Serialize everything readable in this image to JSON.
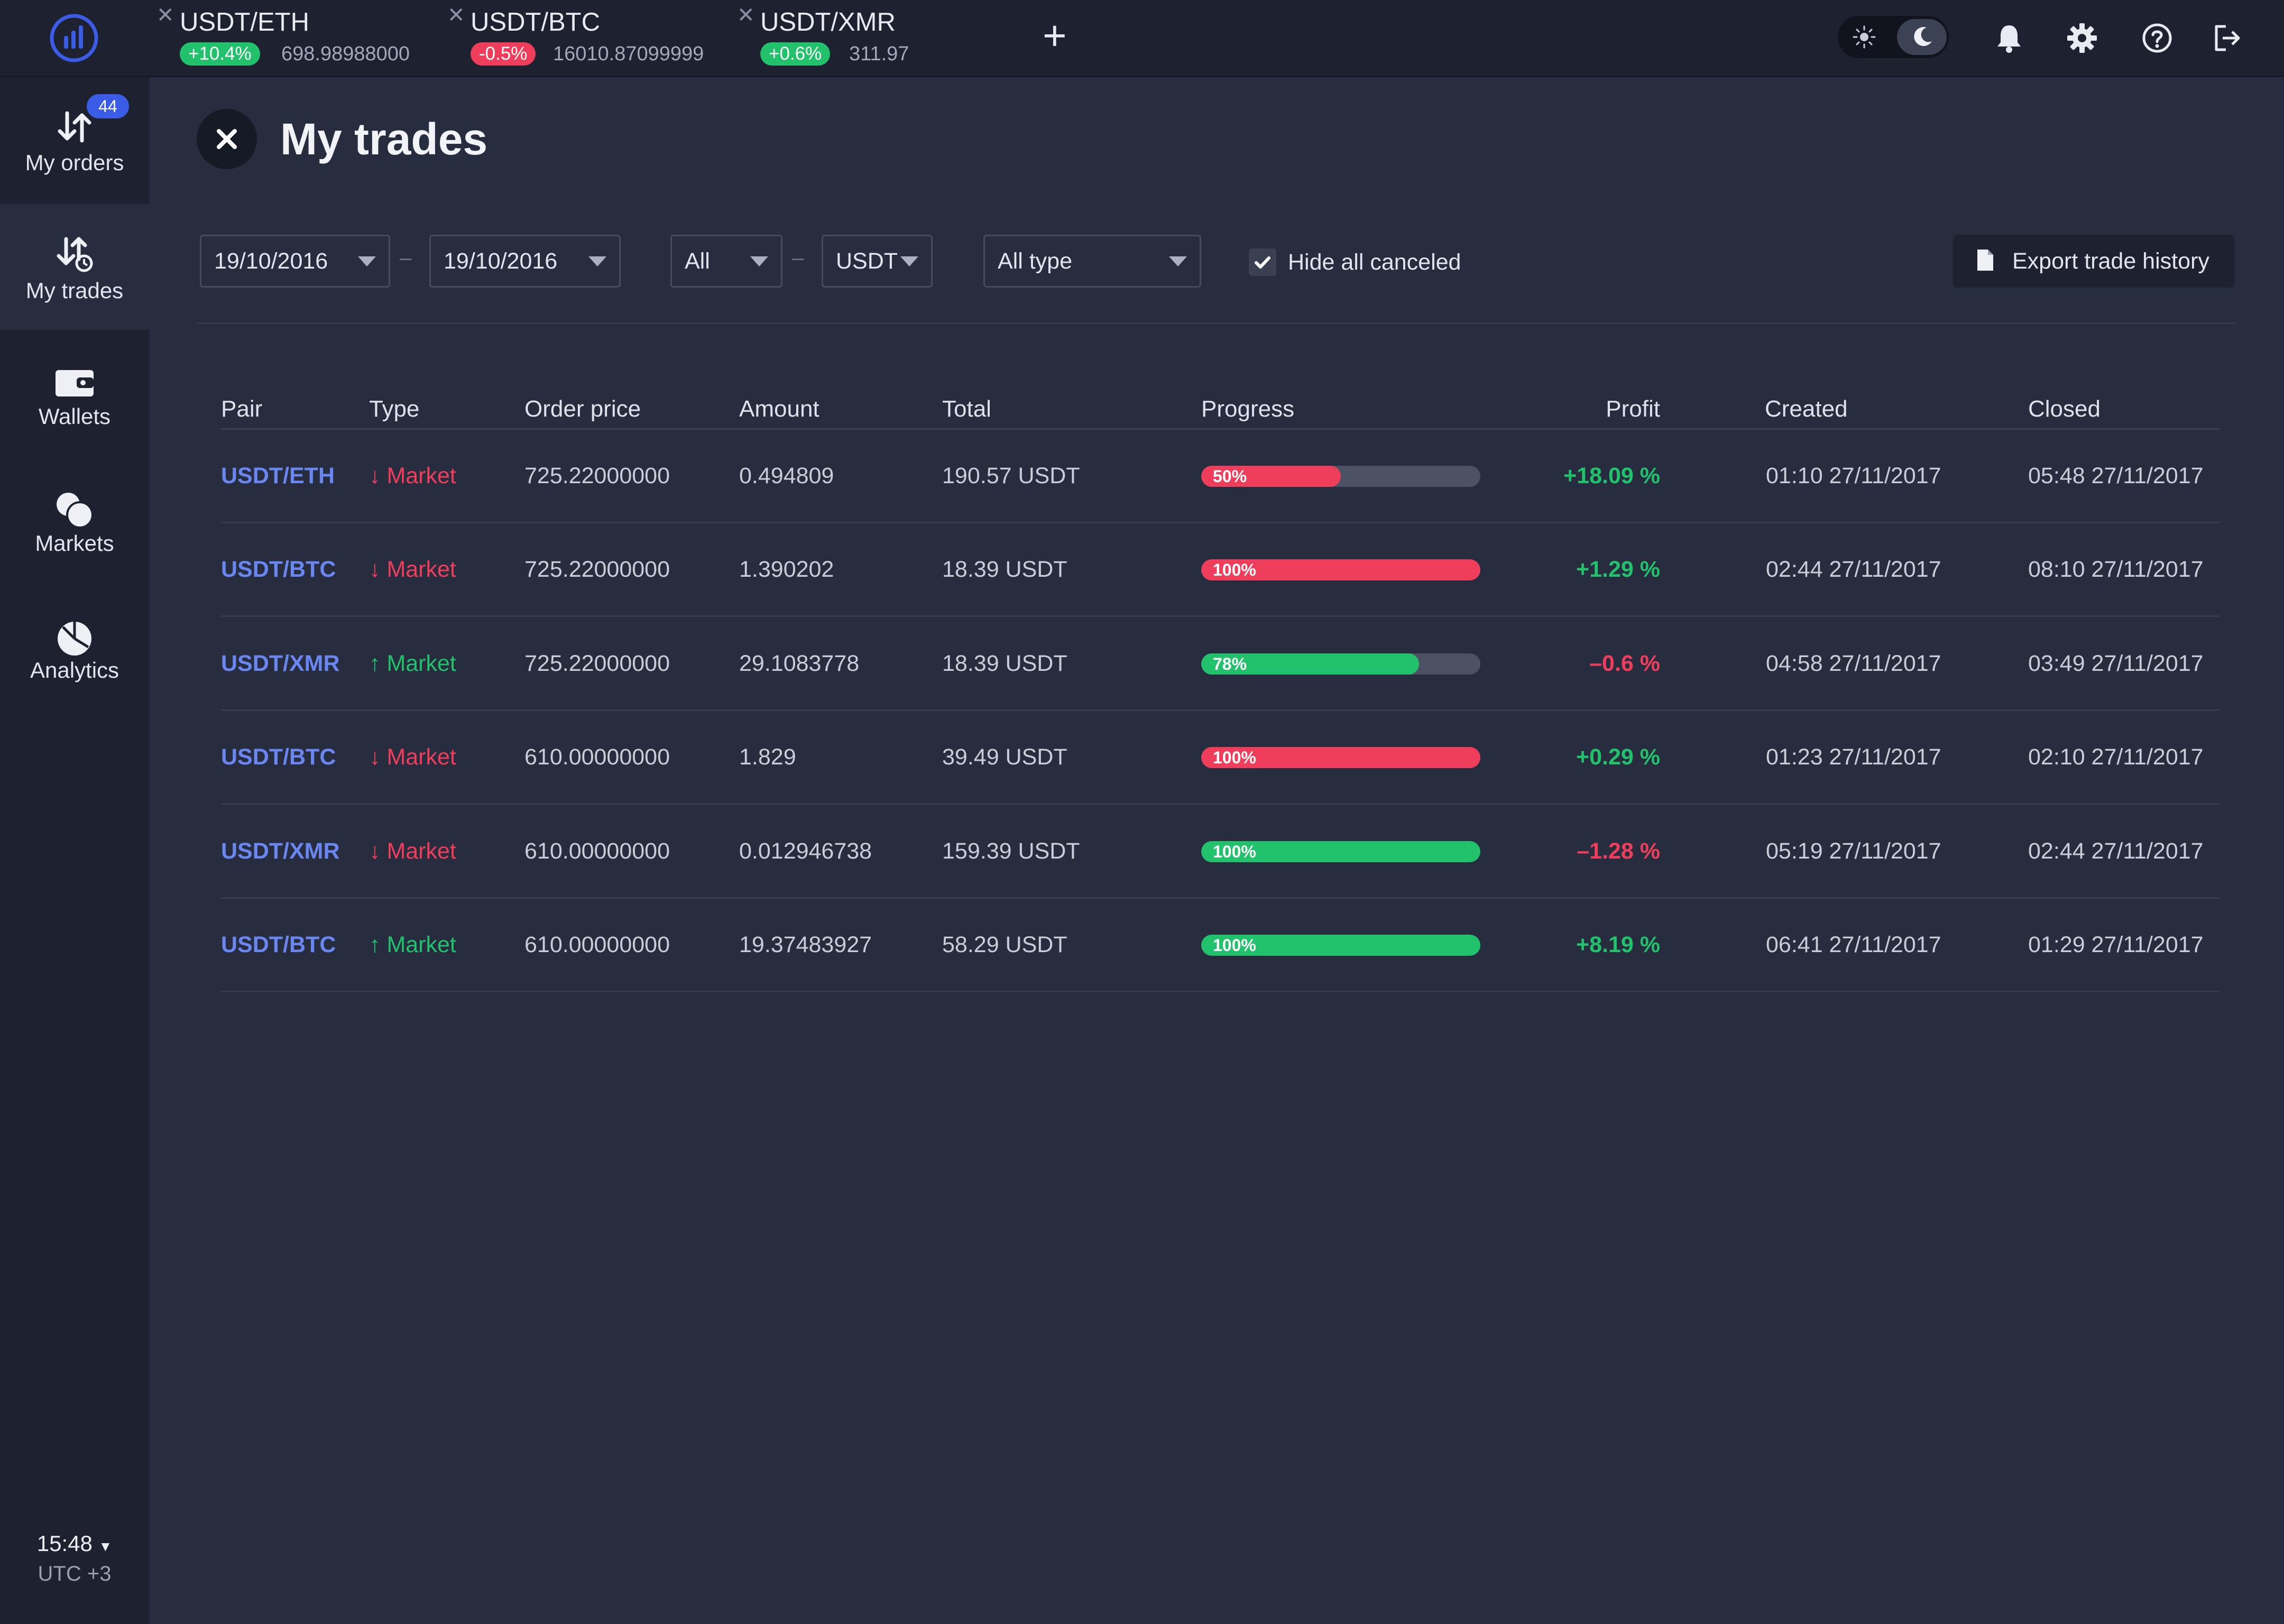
{
  "app": {
    "logo": "chart-logo-icon"
  },
  "tabs": [
    {
      "pair": "USDT/ETH",
      "change": "+10.4%",
      "direction": "up",
      "price": "698.98988000"
    },
    {
      "pair": "USDT/BTC",
      "change": "-0.5%",
      "direction": "down",
      "price": "16010.87099999"
    },
    {
      "pair": "USDT/XMR",
      "change": "+0.6%",
      "direction": "up",
      "price": "311.97"
    }
  ],
  "topbar": {
    "add_tab": "+",
    "icons": [
      "sun-icon",
      "moon-icon",
      "bell-icon",
      "gear-icon",
      "help-icon",
      "logout-icon"
    ]
  },
  "sidebar": {
    "items": [
      {
        "label": "My orders",
        "icon": "orders-arrows-icon",
        "badge": "44"
      },
      {
        "label": "My trades",
        "icon": "trades-arrows-icon"
      },
      {
        "label": "Wallets",
        "icon": "wallet-icon"
      },
      {
        "label": "Markets",
        "icon": "markets-icon"
      },
      {
        "label": "Analytics",
        "icon": "pie-chart-icon"
      }
    ],
    "clock": {
      "time": "15:48",
      "timezone": "UTC +3"
    }
  },
  "page": {
    "title": "My trades"
  },
  "filters": {
    "date_from": "19/10/2016",
    "date_to": "19/10/2016",
    "base": "All",
    "quote": "USDT",
    "type": "All type",
    "hide_canceled_label": "Hide all canceled",
    "hide_canceled_checked": true,
    "export_label": "Export trade history",
    "separator": "–"
  },
  "table": {
    "headers": [
      "Pair",
      "Type",
      "Order price",
      "Amount",
      "Total",
      "Progress",
      "Profit",
      "Created",
      "Closed"
    ],
    "rows": [
      {
        "pair": "USDT/ETH",
        "arrow": "↓",
        "type": "Market",
        "direction": "down",
        "price": "725.22000000",
        "amount": "0.494809",
        "total": "190.57 USDT",
        "progress": 0.5,
        "progress_label": "50%",
        "progress_color": "red",
        "profit": "+18.09 %",
        "profit_sign": "pos",
        "created": "01:10  27/11/2017",
        "closed": "05:48  27/11/2017"
      },
      {
        "pair": "USDT/BTC",
        "arrow": "↓",
        "type": "Market",
        "direction": "down",
        "price": "725.22000000",
        "amount": "1.390202",
        "total": "18.39 USDT",
        "progress": 1.0,
        "progress_label": "100%",
        "progress_color": "red",
        "profit": "+1.29 %",
        "profit_sign": "pos",
        "created": "02:44  27/11/2017",
        "closed": "08:10  27/11/2017"
      },
      {
        "pair": "USDT/XMR",
        "arrow": "↑",
        "type": "Market",
        "direction": "up",
        "price": "725.22000000",
        "amount": "29.1083778",
        "total": "18.39 USDT",
        "progress": 0.78,
        "progress_label": "78%",
        "progress_color": "green",
        "profit": "–0.6 %",
        "profit_sign": "neg",
        "created": "04:58  27/11/2017",
        "closed": "03:49  27/11/2017"
      },
      {
        "pair": "USDT/BTC",
        "arrow": "↓",
        "type": "Market",
        "direction": "down",
        "price": "610.00000000",
        "amount": "1.829",
        "total": "39.49 USDT",
        "progress": 1.0,
        "progress_label": "100%",
        "progress_color": "red",
        "profit": "+0.29 %",
        "profit_sign": "pos",
        "created": "01:23  27/11/2017",
        "closed": "02:10  27/11/2017"
      },
      {
        "pair": "USDT/XMR",
        "arrow": "↓",
        "type": "Market",
        "direction": "down",
        "price": "610.00000000",
        "amount": "0.012946738",
        "total": "159.39 USDT",
        "progress": 1.0,
        "progress_label": "100%",
        "progress_color": "green",
        "profit": "–1.28 %",
        "profit_sign": "neg",
        "created": "05:19  27/11/2017",
        "closed": "02:44  27/11/2017"
      },
      {
        "pair": "USDT/BTC",
        "arrow": "↑",
        "type": "Market",
        "direction": "up",
        "price": "610.00000000",
        "amount": "19.37483927",
        "total": "58.29 USDT",
        "progress": 1.0,
        "progress_label": "100%",
        "progress_color": "green",
        "profit": "+8.19 %",
        "profit_sign": "pos",
        "created": "06:41  27/11/2017",
        "closed": "01:29  27/11/2017"
      }
    ]
  },
  "colors": {
    "accent": "#3a5ce6",
    "positive": "#22c16b",
    "negative": "#ef3e5b",
    "pair_link": "#6a86f0",
    "background": "#272d3e",
    "sidebar": "#1d2130"
  }
}
